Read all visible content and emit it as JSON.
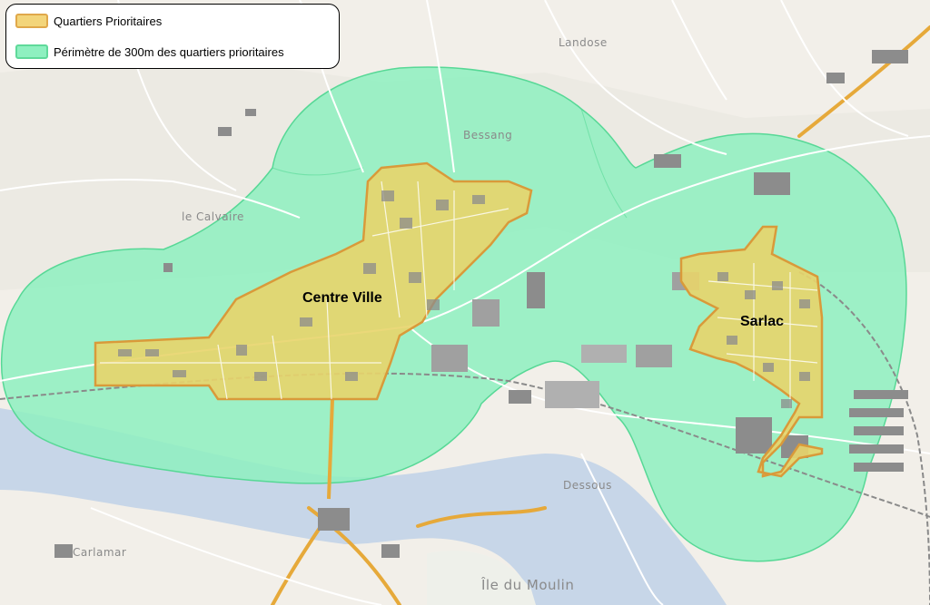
{
  "legend": {
    "items": [
      {
        "label": "Quartiers Prioritaires",
        "fill": "#f3d57a",
        "stroke": "#e0a84a"
      },
      {
        "label": "Périmètre de 300m des quartiers prioritaires",
        "fill": "#8ef0c0",
        "stroke": "#5fd99a"
      }
    ]
  },
  "zones": {
    "centre": "Centre Ville",
    "sarlac": "Sarlac"
  },
  "places": {
    "bessang": "Bessang",
    "landose": "Landose",
    "calvaire": "le Calvaire",
    "dessous": "Dessous",
    "ile": "Île du Moulin",
    "carlamar": "Carlamar"
  },
  "colors": {
    "background": "#f2efe9",
    "river": "#c7d6e8",
    "road_major": "#f6c343",
    "road_minor": "#ffffff",
    "building": "#8c8c8c",
    "rail": "#9a9a9a"
  }
}
